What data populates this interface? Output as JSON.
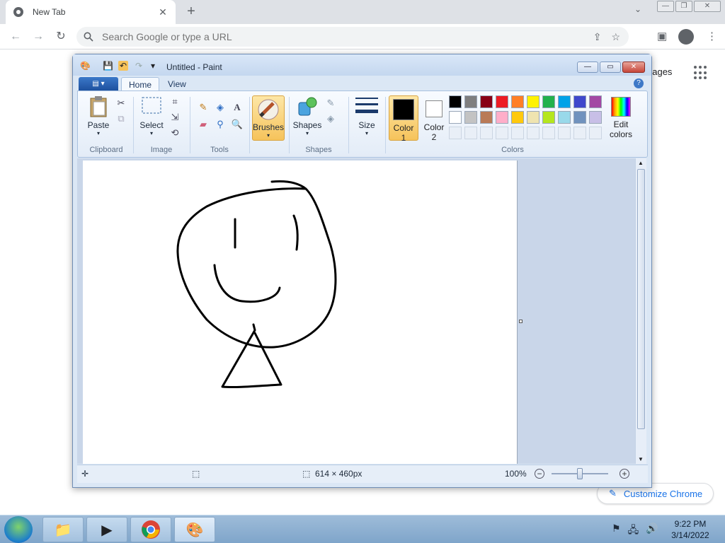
{
  "browser": {
    "tab_title": "New Tab",
    "tab_close": "✕",
    "new_tab": "+",
    "tab_menu": "⌄",
    "omnibox_placeholder": "Search Google or type a URL",
    "images_link": "nages",
    "customize_label": "Customize Chrome"
  },
  "paint": {
    "title": "Untitled - Paint",
    "tabs": [
      "Home",
      "View"
    ],
    "help": "?",
    "groups": {
      "clipboard": "Clipboard",
      "image": "Image",
      "tools": "Tools",
      "shapes": "Shapes",
      "colors": "Colors"
    },
    "buttons": {
      "paste": "Paste",
      "select": "Select",
      "brushes": "Brushes",
      "shapes": "Shapes",
      "size": "Size",
      "color1_line1": "Color",
      "color1_line2": "1",
      "color2_line1": "Color",
      "color2_line2": "2",
      "edit_colors_line1": "Edit",
      "edit_colors_line2": "colors"
    },
    "color1": "#000000",
    "color2": "#ffffff",
    "palette": [
      "#000000",
      "#7f7f7f",
      "#880015",
      "#ed1c24",
      "#ff7f27",
      "#fff200",
      "#22b14c",
      "#00a2e8",
      "#3f48cc",
      "#a349a4",
      "#ffffff",
      "#c3c3c3",
      "#b97a57",
      "#ffaec9",
      "#ffc90e",
      "#efe4b0",
      "#b5e61d",
      "#99d9ea",
      "#7092be",
      "#c8bfe7"
    ],
    "status": {
      "canvas_size": "614 × 460px",
      "zoom": "100%"
    }
  },
  "taskbar": {
    "time": "9:22 PM",
    "date": "3/14/2022"
  }
}
